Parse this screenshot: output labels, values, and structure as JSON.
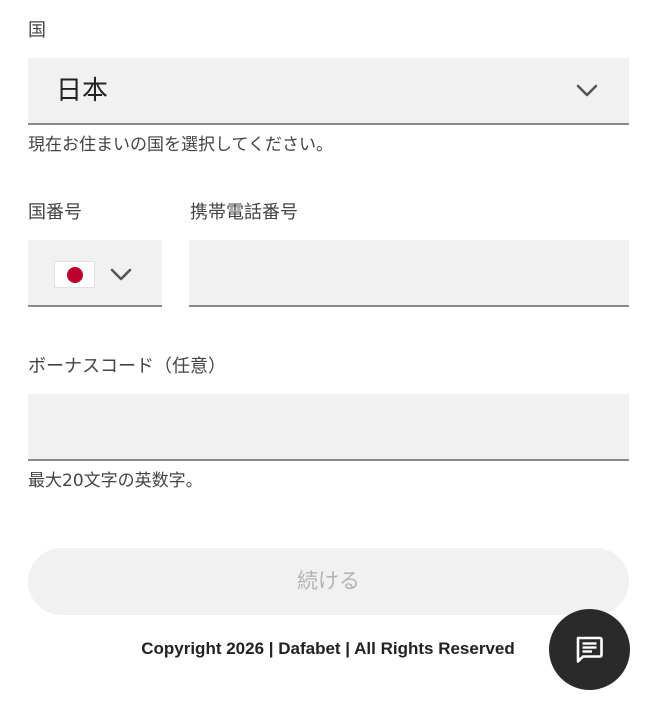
{
  "country": {
    "label": "国",
    "selected": "日本",
    "helper": "現在お住まいの国を選択してください。"
  },
  "phone": {
    "code_label": "国番号",
    "code_flag_icon": "japan-flag-icon",
    "number_label": "携帯電話番号",
    "number_value": ""
  },
  "bonus": {
    "label": "ボーナスコード（任意）",
    "value": "",
    "helper": "最大20文字の英数字。"
  },
  "actions": {
    "continue_label": "続ける"
  },
  "footer": {
    "copyright": "Copyright 2026 | Dafabet | All Rights Reserved"
  },
  "chat": {
    "icon": "chat-icon"
  },
  "colors": {
    "field_bg": "#f1f1f1",
    "field_underline": "#8a8a8a",
    "button_disabled_text": "#b3b3b3",
    "chat_bg": "#2a2a2a",
    "flag_red": "#bc002d"
  }
}
